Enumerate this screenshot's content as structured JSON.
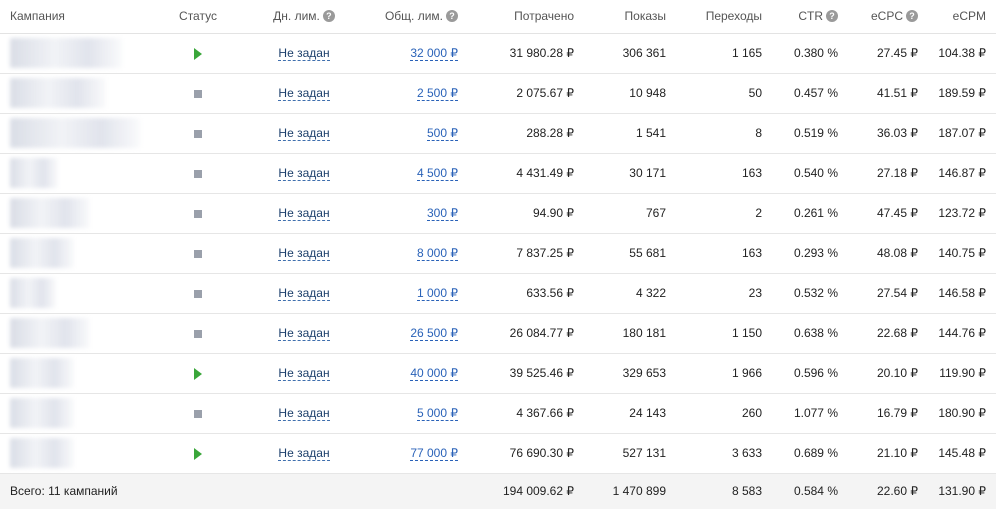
{
  "columns": {
    "campaign": "Кампания",
    "status": "Статус",
    "daily_limit": "Дн. лим.",
    "total_limit": "Общ. лим.",
    "spent": "Потрачено",
    "impressions": "Показы",
    "clicks": "Переходы",
    "ctr": "CTR",
    "ecpc": "eCPC",
    "ecpm": "eCPM"
  },
  "help_glyph": "?",
  "status_colors": {
    "running": "#3aa63a",
    "stopped": "#9aa0ab"
  },
  "rows": [
    {
      "status": "running",
      "daily_limit": "Не задан",
      "total_limit": "32 000 ₽",
      "spent": "31 980.28 ₽",
      "impressions": "306 361",
      "clicks": "1 165",
      "ctr": "0.380 %",
      "ecpc": "27.45 ₽",
      "ecpm": "104.38 ₽"
    },
    {
      "status": "stopped",
      "daily_limit": "Не задан",
      "total_limit": "2 500 ₽",
      "spent": "2 075.67 ₽",
      "impressions": "10 948",
      "clicks": "50",
      "ctr": "0.457 %",
      "ecpc": "41.51 ₽",
      "ecpm": "189.59 ₽"
    },
    {
      "status": "stopped",
      "daily_limit": "Не задан",
      "total_limit": "500 ₽",
      "spent": "288.28 ₽",
      "impressions": "1 541",
      "clicks": "8",
      "ctr": "0.519 %",
      "ecpc": "36.03 ₽",
      "ecpm": "187.07 ₽"
    },
    {
      "status": "stopped",
      "daily_limit": "Не задан",
      "total_limit": "4 500 ₽",
      "spent": "4 431.49 ₽",
      "impressions": "30 171",
      "clicks": "163",
      "ctr": "0.540 %",
      "ecpc": "27.18 ₽",
      "ecpm": "146.87 ₽"
    },
    {
      "status": "stopped",
      "daily_limit": "Не задан",
      "total_limit": "300 ₽",
      "spent": "94.90 ₽",
      "impressions": "767",
      "clicks": "2",
      "ctr": "0.261 %",
      "ecpc": "47.45 ₽",
      "ecpm": "123.72 ₽"
    },
    {
      "status": "stopped",
      "daily_limit": "Не задан",
      "total_limit": "8 000 ₽",
      "spent": "7 837.25 ₽",
      "impressions": "55 681",
      "clicks": "163",
      "ctr": "0.293 %",
      "ecpc": "48.08 ₽",
      "ecpm": "140.75 ₽"
    },
    {
      "status": "stopped",
      "daily_limit": "Не задан",
      "total_limit": "1 000 ₽",
      "spent": "633.56 ₽",
      "impressions": "4 322",
      "clicks": "23",
      "ctr": "0.532 %",
      "ecpc": "27.54 ₽",
      "ecpm": "146.58 ₽"
    },
    {
      "status": "stopped",
      "daily_limit": "Не задан",
      "total_limit": "26 500 ₽",
      "spent": "26 084.77 ₽",
      "impressions": "180 181",
      "clicks": "1 150",
      "ctr": "0.638 %",
      "ecpc": "22.68 ₽",
      "ecpm": "144.76 ₽"
    },
    {
      "status": "running",
      "daily_limit": "Не задан",
      "total_limit": "40 000 ₽",
      "spent": "39 525.46 ₽",
      "impressions": "329 653",
      "clicks": "1 966",
      "ctr": "0.596 %",
      "ecpc": "20.10 ₽",
      "ecpm": "119.90 ₽"
    },
    {
      "status": "stopped",
      "daily_limit": "Не задан",
      "total_limit": "5 000 ₽",
      "spent": "4 367.66 ₽",
      "impressions": "24 143",
      "clicks": "260",
      "ctr": "1.077 %",
      "ecpc": "16.79 ₽",
      "ecpm": "180.90 ₽"
    },
    {
      "status": "running",
      "daily_limit": "Не задан",
      "total_limit": "77 000 ₽",
      "spent": "76 690.30 ₽",
      "impressions": "527 131",
      "clicks": "3 633",
      "ctr": "0.689 %",
      "ecpc": "21.10 ₽",
      "ecpm": "145.48 ₽"
    }
  ],
  "totals": {
    "label": "Всего: 11 кампаний",
    "spent": "194 009.62 ₽",
    "impressions": "1 470 899",
    "clicks": "8 583",
    "ctr": "0.584 %",
    "ecpc": "22.60 ₽",
    "ecpm": "131.90 ₽"
  }
}
